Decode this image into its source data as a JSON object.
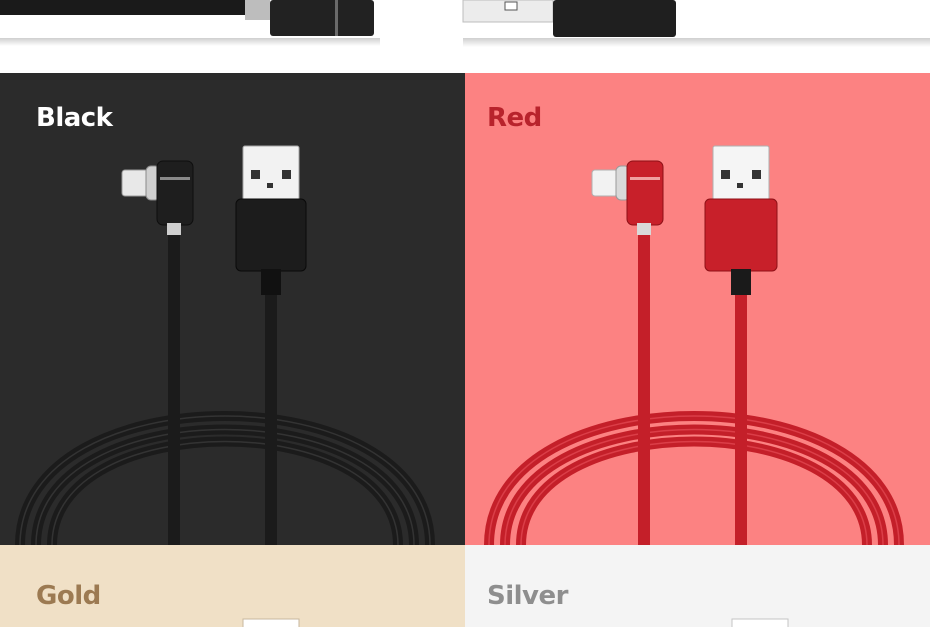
{
  "tiles": {
    "black": {
      "label": "Black",
      "background": "#2b2b2b",
      "cable_color": "#1c1c1c",
      "label_color": "#ffffff"
    },
    "red": {
      "label": "Red",
      "background": "#fc8282",
      "cable_color": "#c8202a",
      "label_color": "#b8232c"
    },
    "gold": {
      "label": "Gold",
      "background": "#f0e0c6",
      "label_color": "#9c7a52"
    },
    "silver": {
      "label": "Silver",
      "background": "#f4f4f4",
      "label_color": "#8e8e8e"
    }
  }
}
